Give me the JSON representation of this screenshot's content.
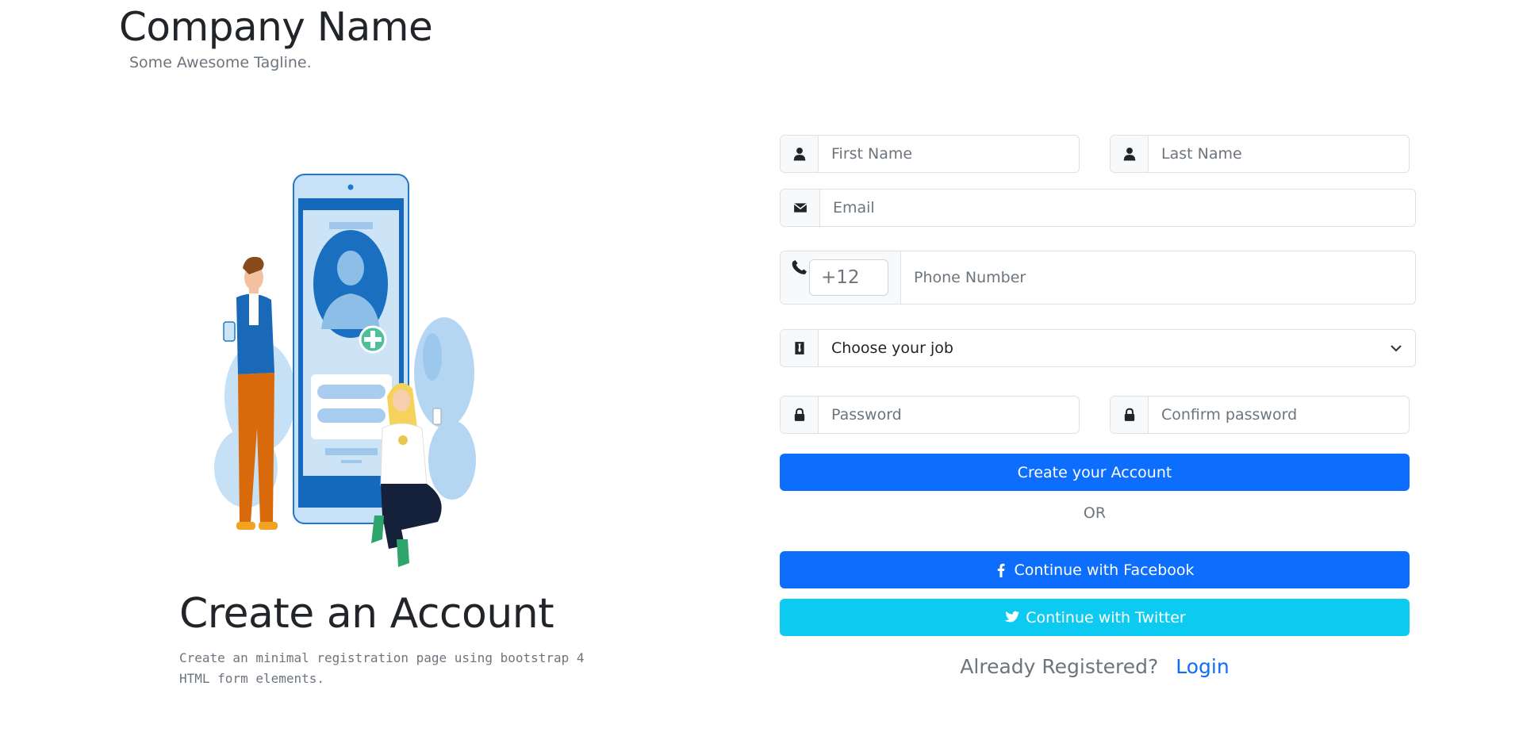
{
  "brand": {
    "title": "Company Name",
    "tagline": "Some Awesome Tagline."
  },
  "intro": {
    "title": "Create an Account",
    "description_line1": "Create an minimal registration page using bootstrap 4",
    "description_line2": "HTML form elements."
  },
  "form": {
    "first_name_placeholder": "First Name",
    "last_name_placeholder": "Last Name",
    "email_placeholder": "Email",
    "phone_code": "+12",
    "phone_placeholder": "Phone Number",
    "job_selected": "Choose your job",
    "password_placeholder": "Password",
    "confirm_password_placeholder": "Confirm password",
    "submit_label": "Create your Account",
    "or_label": "OR",
    "facebook_label": "Continue with Facebook",
    "twitter_label": "Continue with Twitter",
    "already_registered": "Already Registered?",
    "login_label": "Login"
  },
  "colors": {
    "primary": "#0d6efd",
    "info": "#0dcaf0",
    "muted": "#6c757d",
    "border": "#dee2e6"
  },
  "icons": [
    "user-icon",
    "envelope-icon",
    "phone-icon",
    "briefcase-icon",
    "chevron-down-icon",
    "lock-icon",
    "facebook-icon",
    "twitter-icon"
  ]
}
